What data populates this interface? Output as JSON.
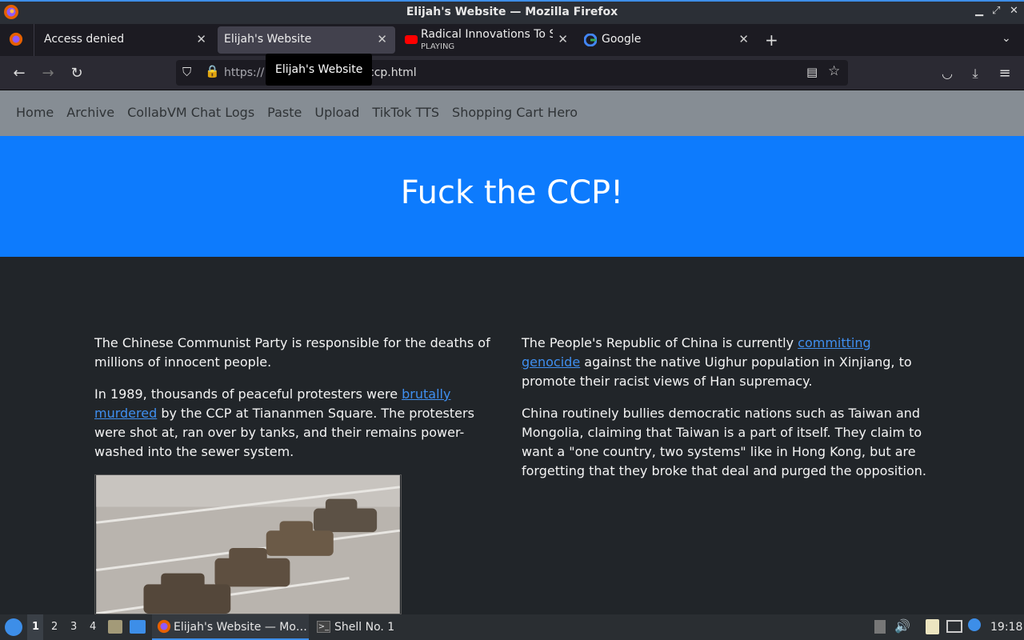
{
  "window": {
    "title": "Elijah's Website — Mozilla Firefox"
  },
  "tabs": [
    {
      "label": "Access denied"
    },
    {
      "label": "Elijah's Website"
    },
    {
      "label": "Radical Innovations To Si",
      "sub": "PLAYING"
    },
    {
      "label": "Google"
    }
  ],
  "tooltip": "Elijah's Website",
  "urlbar": {
    "prefix": "https://",
    "suffix": "ccp.html"
  },
  "sitenav": [
    "Home",
    "Archive",
    "CollabVM Chat Logs",
    "Paste",
    "Upload",
    "TikTok TTS",
    "Shopping Cart Hero"
  ],
  "hero": {
    "title": "Fuck the CCP!"
  },
  "left": {
    "p1": "The Chinese Communist Party is responsible for the deaths of millions of innocent people.",
    "p2_pre": "In 1989, thousands of peaceful protesters were ",
    "p2_link": "brutally murdered",
    "p2_post": " by the CCP at Tiananmen Square. The protesters were shot at, ran over by tanks, and their remains power-washed into the sewer system."
  },
  "right": {
    "p1_pre": "The People's Republic of China is currently ",
    "p1_link": "committing genocide",
    "p1_post": " against the native Uighur population in Xinjiang, to promote their racist views of Han supremacy.",
    "p2": "China routinely bullies democratic nations such as Taiwan and Mongolia, claiming that Taiwan is a part of itself. They claim to want a \"one country, two systems\" like in Hong Kong, but are forgetting that they broke that deal and purged the opposition."
  },
  "taskbar": {
    "workspaces": [
      "1",
      "2",
      "3",
      "4"
    ],
    "firefox_task": "Elijah's Website — Mo…",
    "shell_task": "Shell No. 1",
    "clock": "19:18"
  },
  "colors": {
    "hero": "#0d7bfd",
    "sitenav": "#868d94",
    "body": "#212529",
    "link": "#3f8ff0"
  }
}
